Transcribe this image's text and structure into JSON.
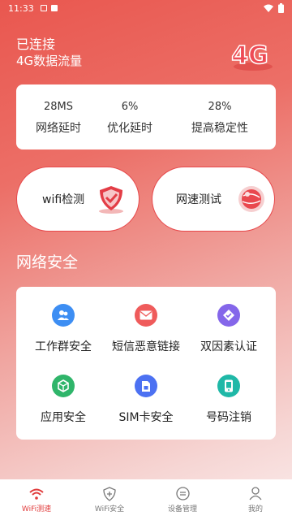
{
  "status_bar": {
    "time": "11:33"
  },
  "header": {
    "title": "已连接",
    "subtitle": "4G数据流量",
    "badge": "4G"
  },
  "stats": [
    {
      "value": "28MS",
      "label": "网络延时"
    },
    {
      "value": "6%",
      "label": "优化延时"
    },
    {
      "value": "28%",
      "label": "提高稳定性"
    }
  ],
  "actions": {
    "wifi_check": "wifi检测",
    "speed_test": "网速测试"
  },
  "section": {
    "title": "网络安全"
  },
  "grid": [
    {
      "label": "工作群安全",
      "icon": "group-icon",
      "color": "#3d8ef3"
    },
    {
      "label": "短信恶意链接",
      "icon": "mail-icon",
      "color": "#ef5b5b"
    },
    {
      "label": "双因素认证",
      "icon": "verify-icon",
      "color": "#8466ea"
    },
    {
      "label": "应用安全",
      "icon": "cube-icon",
      "color": "#2fb56a"
    },
    {
      "label": "SIM卡安全",
      "icon": "sim-icon",
      "color": "#4c71f2"
    },
    {
      "label": "号码注销",
      "icon": "phone-icon",
      "color": "#1fb8a7"
    }
  ],
  "tabs": [
    {
      "label": "WiFi测速",
      "active": true
    },
    {
      "label": "WiFi安全"
    },
    {
      "label": "设备管理"
    },
    {
      "label": "我的"
    }
  ],
  "colors": {
    "accent": "#e03a3a",
    "background_top": "#e9574f"
  }
}
